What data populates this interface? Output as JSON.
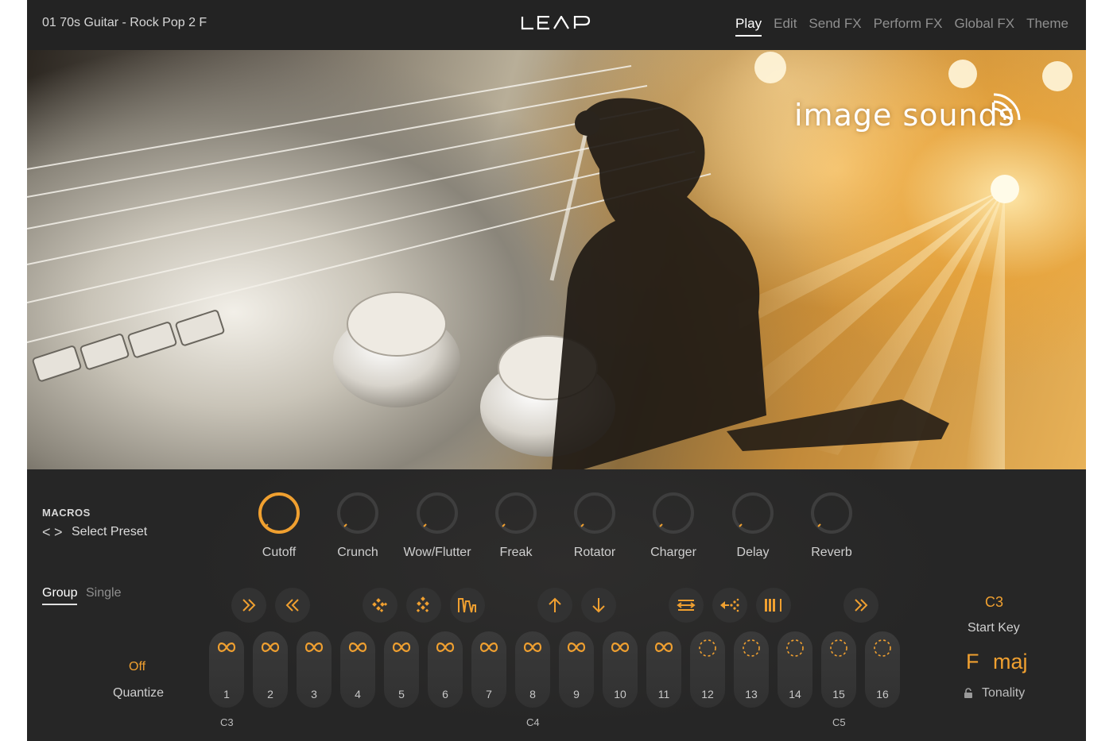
{
  "header": {
    "preset_name": "01 70s Guitar - Rock Pop 2 F",
    "logo_text": "LEAP",
    "tabs": [
      {
        "label": "Play",
        "active": true
      },
      {
        "label": "Edit",
        "active": false
      },
      {
        "label": "Send FX",
        "active": false
      },
      {
        "label": "Perform FX",
        "active": false
      },
      {
        "label": "Global FX",
        "active": false
      },
      {
        "label": "Theme",
        "active": false
      }
    ]
  },
  "hero": {
    "brand_text": "image sounds"
  },
  "macros": {
    "title": "MACROS",
    "prev_symbol": "<",
    "next_symbol": ">",
    "select_preset": "Select Preset",
    "knobs": [
      {
        "label": "Cutoff",
        "value": 1.0
      },
      {
        "label": "Crunch",
        "value": 0.0
      },
      {
        "label": "Wow/Flutter",
        "value": 0.0
      },
      {
        "label": "Freak",
        "value": 0.0
      },
      {
        "label": "Rotator",
        "value": 0.0
      },
      {
        "label": "Charger",
        "value": 0.0
      },
      {
        "label": "Delay",
        "value": 0.0
      },
      {
        "label": "Reverb",
        "value": 0.0
      }
    ]
  },
  "mode_tabs": {
    "group": "Group",
    "single": "Single",
    "active": "Group"
  },
  "quantize": {
    "value": "Off",
    "label": "Quantize"
  },
  "actions": [
    "fast-forward-icon",
    "rewind-icon",
    "shuffle-icon",
    "randomize-icon",
    "envelope-icon",
    "pitch-up-icon",
    "pitch-down-icon",
    "reverse-icon",
    "scatter-icon",
    "slice-icon",
    "double-forward-icon"
  ],
  "pads": [
    {
      "number": "1",
      "loop": true
    },
    {
      "number": "2",
      "loop": true
    },
    {
      "number": "3",
      "loop": true
    },
    {
      "number": "4",
      "loop": true
    },
    {
      "number": "5",
      "loop": true
    },
    {
      "number": "6",
      "loop": true
    },
    {
      "number": "7",
      "loop": true
    },
    {
      "number": "8",
      "loop": true
    },
    {
      "number": "9",
      "loop": true
    },
    {
      "number": "10",
      "loop": true
    },
    {
      "number": "11",
      "loop": true
    },
    {
      "number": "12",
      "loop": false
    },
    {
      "number": "13",
      "loop": false
    },
    {
      "number": "14",
      "loop": false
    },
    {
      "number": "15",
      "loop": false
    },
    {
      "number": "16",
      "loop": false
    }
  ],
  "octave_labels": [
    "C3",
    "C4",
    "C5"
  ],
  "key": {
    "start_key_value": "C3",
    "start_key_label": "Start Key",
    "tonality_root": "F",
    "tonality_mode": "maj",
    "tonality_label": "Tonality"
  },
  "colors": {
    "accent": "#f0a030",
    "background": "#262626",
    "pad": "#363636"
  }
}
